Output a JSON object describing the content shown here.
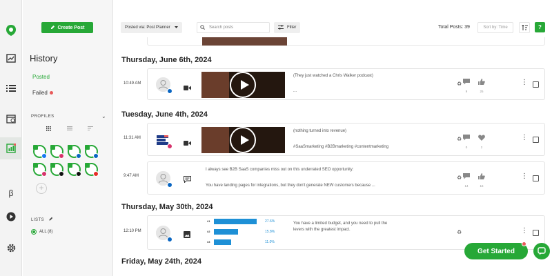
{
  "colors": {
    "brand": "#27a837",
    "failed_dot": "#e85a5a",
    "linkedin": "#0a66c2",
    "instagram": "#d6336c",
    "chart_bar": "#1e90d6"
  },
  "rail": {
    "icons": [
      "logo-icon",
      "analytics-icon",
      "list-icon",
      "calendar-icon",
      "history-icon",
      "beta-icon",
      "video-icon",
      "settings-icon"
    ],
    "beta_label": "β"
  },
  "sidebar": {
    "create_post": "Create Post",
    "title": "History",
    "posted": "Posted",
    "failed": "Failed",
    "profiles_label": "PROFILES",
    "lists_label": "LISTS",
    "all_lists": "ALL (8)"
  },
  "toolbar": {
    "posted_via": "Posted via: Post Planner",
    "search_placeholder": "Search posts",
    "filter": "Filter",
    "total": "Total Posts: 39",
    "sort": "Sort by: Time",
    "help": "?"
  },
  "feed": {
    "dates": [
      "Thursday, June 6th, 2024",
      "Tuesday, June 4th, 2024",
      "Thursday, May 30th, 2024",
      "Friday, May 24th, 2024"
    ],
    "posts": [
      {
        "time": "10:49 AM",
        "type": "video",
        "line1": "(They just watched a Chris Walker podcast)",
        "line2": "...",
        "comments": "9",
        "likes": "25"
      },
      {
        "time": "11:31 AM",
        "type": "video",
        "line1": "(nothing turned into revenue)",
        "line2": "#SaaSmarketing #B2Bmarketing #contentmarketing",
        "comments": "0",
        "likes": "2"
      },
      {
        "time": "9:47 AM",
        "type": "text",
        "line1": "I always see B2B SaaS companies miss out on this underrated SEO opportunity:",
        "line2": "You have landing pages for integrations, but they don't generate NEW customers because ...",
        "comments": "14",
        "likes": "16"
      },
      {
        "time": "12:10 PM",
        "type": "image",
        "line1": "You have a limited budget, and you need to pull the",
        "line2": "levers with the greatest impact.",
        "comments": "",
        "likes": ""
      }
    ]
  },
  "mini_chart": {
    "ranks": [
      "#1",
      "#2",
      "#3"
    ],
    "values": [
      27.6,
      15.8,
      11.0
    ],
    "labels": [
      "27.6%",
      "15.8%",
      "11.0%"
    ]
  },
  "floating": {
    "get_started": "Get Started"
  }
}
